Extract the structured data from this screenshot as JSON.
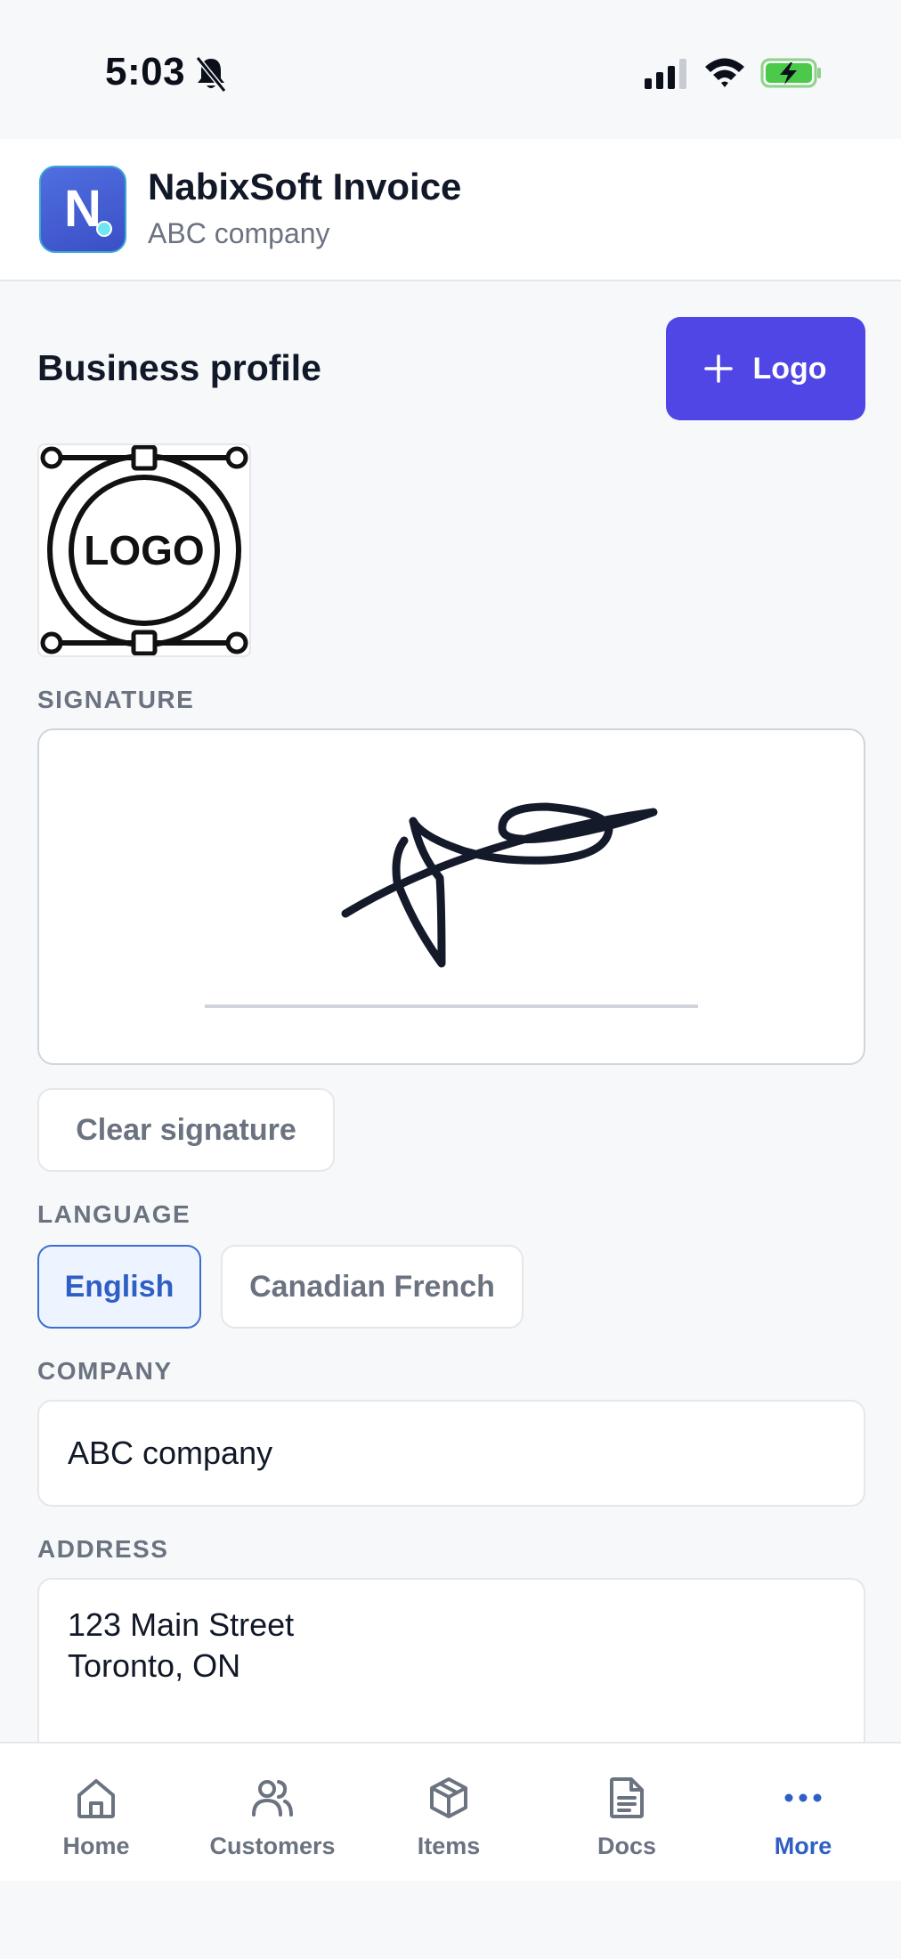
{
  "status_bar": {
    "time": "5:03"
  },
  "header": {
    "app_name": "NabixSoft Invoice",
    "company": "ABC company",
    "logo_letter": "N"
  },
  "profile": {
    "title": "Business profile",
    "add_logo_label": "Logo",
    "logo_text": "LOGO",
    "signature_label": "SIGNATURE",
    "clear_signature_label": "Clear signature",
    "language_label": "LANGUAGE",
    "languages": [
      {
        "label": "English",
        "selected": true
      },
      {
        "label": "Canadian French",
        "selected": false
      }
    ],
    "company_label": "COMPANY",
    "company_value": "ABC company",
    "address_label": "ADDRESS",
    "address_lines": [
      "123 Main Street",
      "Toronto, ON"
    ]
  },
  "nav": {
    "items": [
      {
        "label": "Home",
        "icon": "home-icon"
      },
      {
        "label": "Customers",
        "icon": "users-icon"
      },
      {
        "label": "Items",
        "icon": "box-icon"
      },
      {
        "label": "Docs",
        "icon": "document-icon"
      },
      {
        "label": "More",
        "icon": "more-icon",
        "active": true
      }
    ]
  },
  "colors": {
    "accent": "#4f46e5",
    "active": "#2f5fc4",
    "muted": "#6b7280"
  }
}
